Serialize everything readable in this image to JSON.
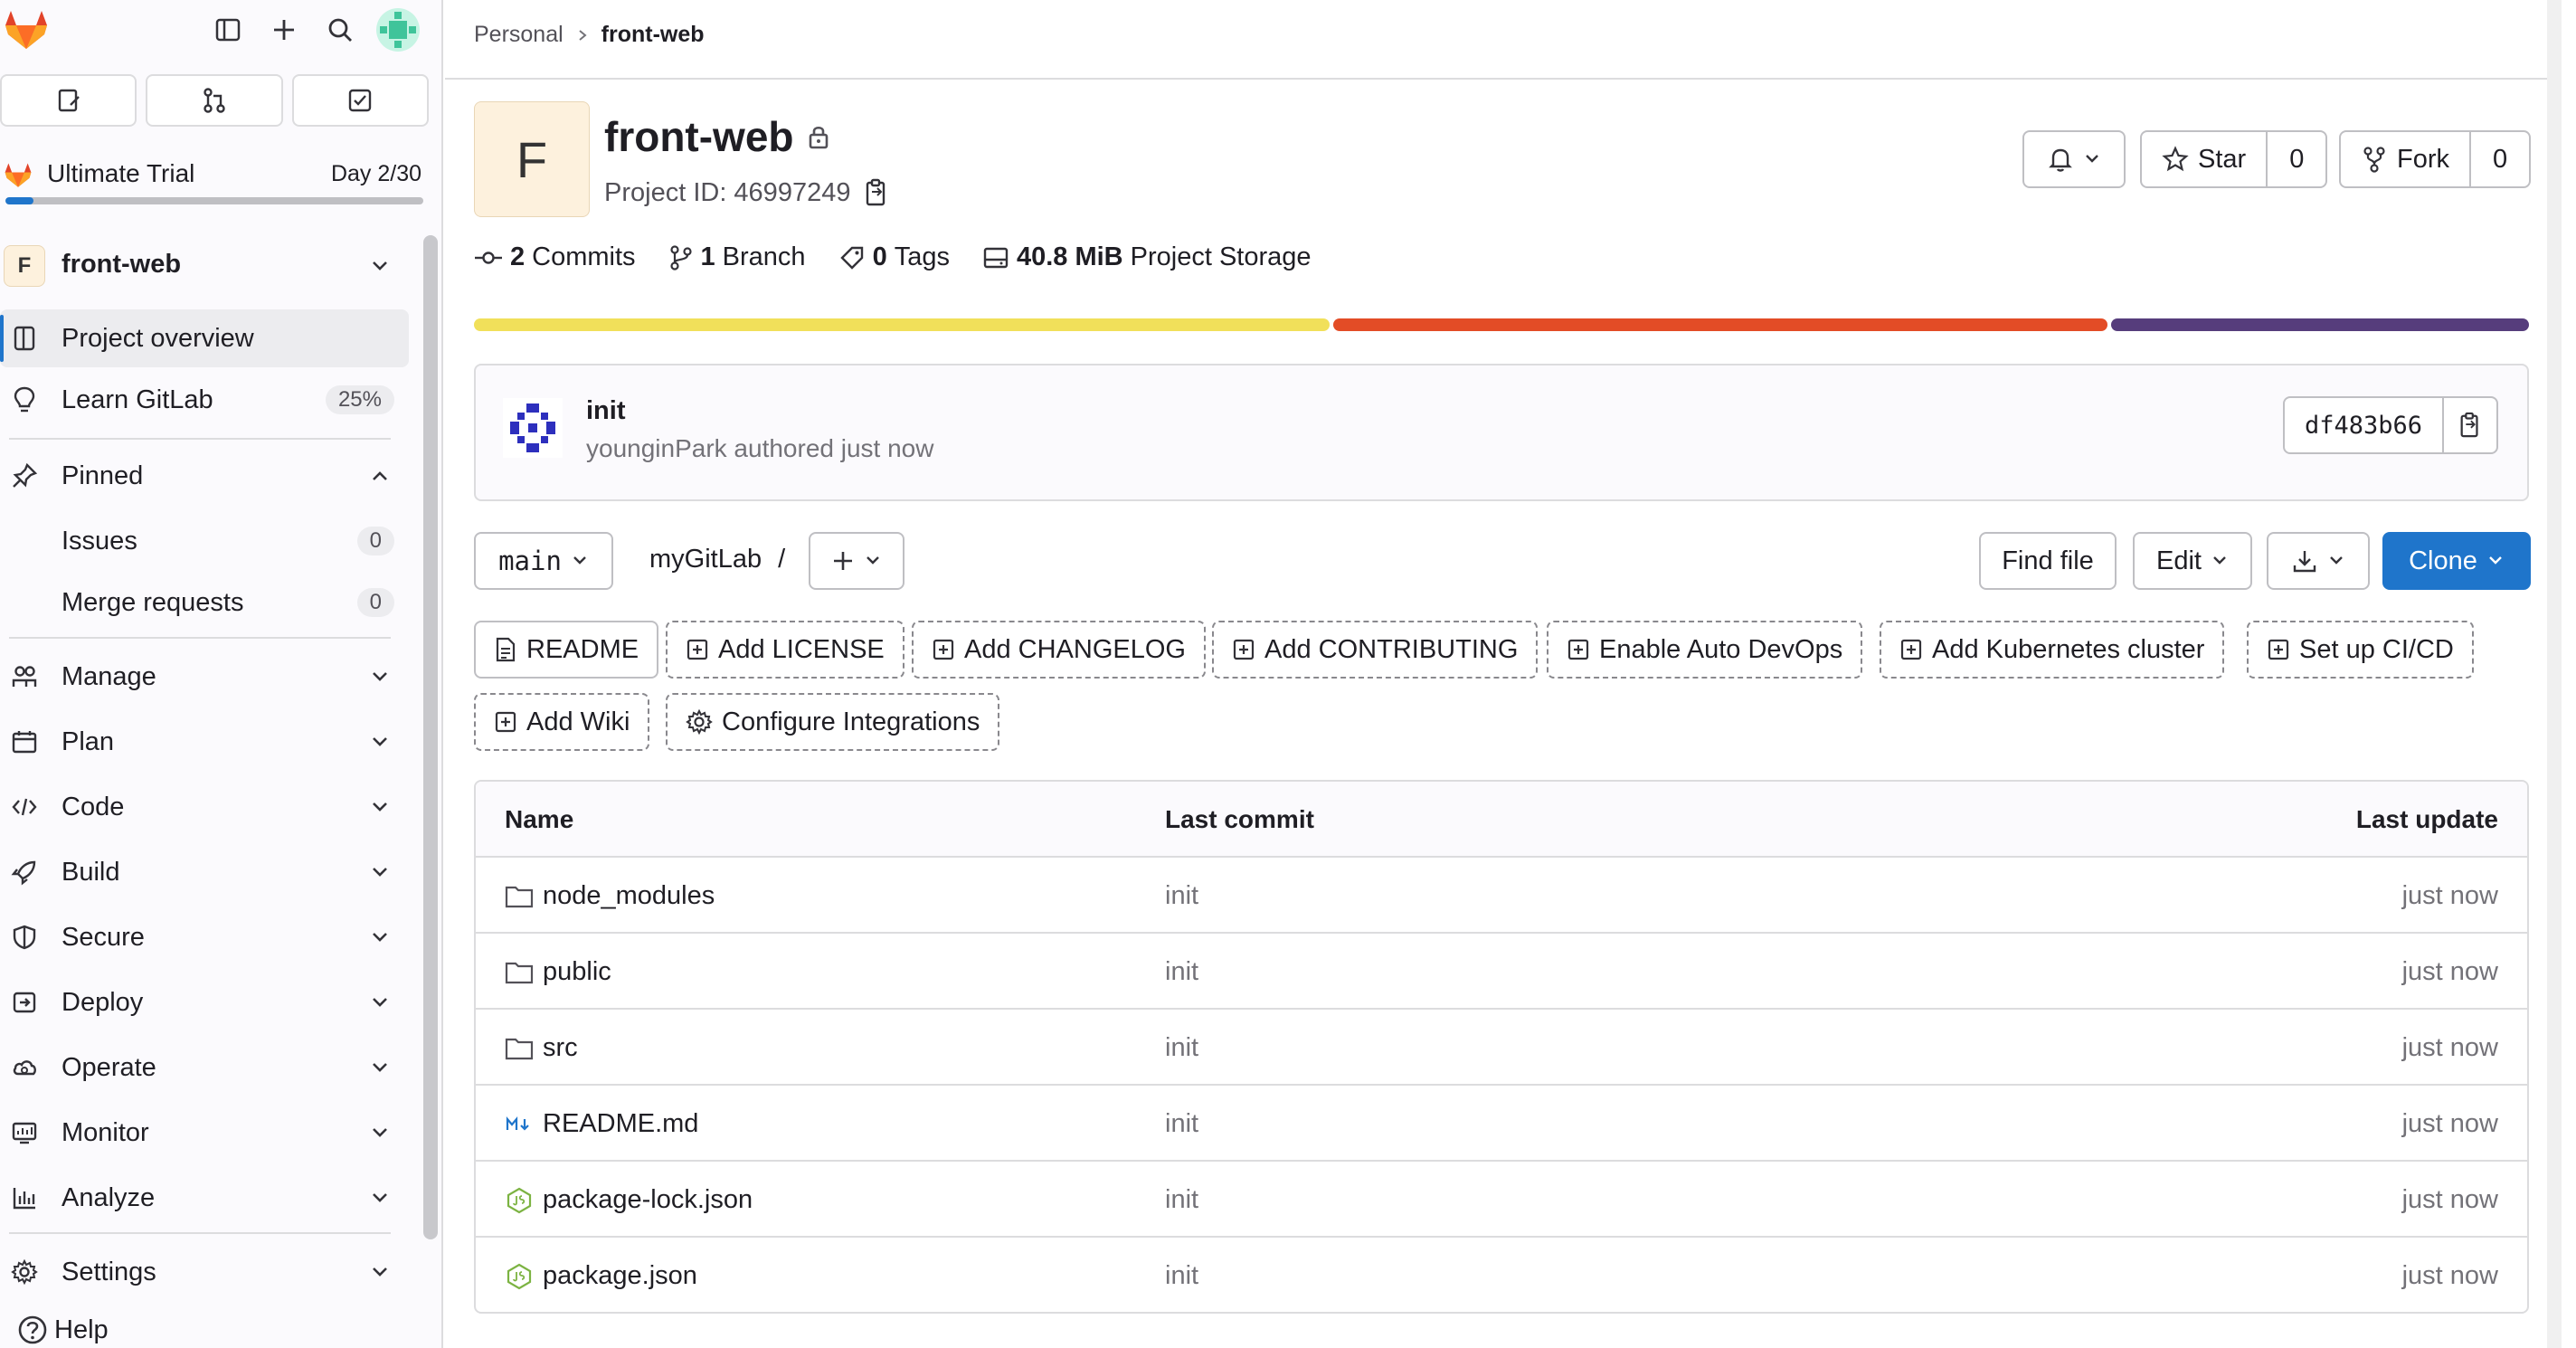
{
  "sidebar": {
    "trial_label": "Ultimate Trial",
    "trial_day": "Day 2/30",
    "trial_progress": 0.067,
    "project_initial": "F",
    "project_name": "front-web",
    "nav": [
      {
        "label": "Project overview",
        "icon": "project-icon",
        "active": true
      },
      {
        "label": "Learn GitLab",
        "icon": "bulb-icon",
        "badge": "25%"
      }
    ],
    "pinned_label": "Pinned",
    "pinned": [
      {
        "label": "Issues",
        "badge": "0"
      },
      {
        "label": "Merge requests",
        "badge": "0"
      }
    ],
    "sections": [
      {
        "label": "Manage",
        "icon": "users-icon"
      },
      {
        "label": "Plan",
        "icon": "planning-icon"
      },
      {
        "label": "Code",
        "icon": "code-icon"
      },
      {
        "label": "Build",
        "icon": "rocket-icon"
      },
      {
        "label": "Secure",
        "icon": "shield-icon"
      },
      {
        "label": "Deploy",
        "icon": "deploy-icon"
      },
      {
        "label": "Operate",
        "icon": "cloud-gear-icon"
      },
      {
        "label": "Monitor",
        "icon": "monitor-icon"
      },
      {
        "label": "Analyze",
        "icon": "chart-icon"
      }
    ],
    "settings_label": "Settings",
    "help_label": "Help"
  },
  "breadcrumb": {
    "parent": "Personal",
    "current": "front-web"
  },
  "project": {
    "initial": "F",
    "title": "front-web",
    "id_text": "Project ID: 46997249"
  },
  "actions": {
    "star_label": "Star",
    "star_count": "0",
    "fork_label": "Fork",
    "fork_count": "0"
  },
  "stats": {
    "commits_num": "2",
    "commits_label": "Commits",
    "branch_num": "1",
    "branch_label": "Branch",
    "tags_num": "0",
    "tags_label": "Tags",
    "storage_num": "40.8 MiB",
    "storage_label": "Project Storage"
  },
  "languages": [
    {
      "share": 41.8,
      "color": "#f1e05a"
    },
    {
      "share": 37.8,
      "color": "#e34c26"
    },
    {
      "share": 20.4,
      "color": "#563d7c"
    }
  ],
  "commit": {
    "title": "init",
    "meta": "younginPark authored just now",
    "sha": "df483b66"
  },
  "repo": {
    "branch": "main",
    "path": "myGitLab",
    "path_sep": "/",
    "find_file": "Find file",
    "edit": "Edit",
    "clone": "Clone"
  },
  "quick_actions": [
    "README",
    "Add LICENSE",
    "Add CHANGELOG",
    "Add CONTRIBUTING",
    "Enable Auto DevOps",
    "Add Kubernetes cluster",
    "Set up CI/CD",
    "Add Wiki",
    "Configure Integrations"
  ],
  "table": {
    "headers": {
      "name": "Name",
      "commit": "Last commit",
      "update": "Last update"
    },
    "rows": [
      {
        "name": "node_modules",
        "type": "folder",
        "commit": "init",
        "update": "just now"
      },
      {
        "name": "public",
        "type": "folder",
        "commit": "init",
        "update": "just now"
      },
      {
        "name": "src",
        "type": "folder",
        "commit": "init",
        "update": "just now"
      },
      {
        "name": "README.md",
        "type": "markdown",
        "commit": "init",
        "update": "just now"
      },
      {
        "name": "package-lock.json",
        "type": "node",
        "commit": "init",
        "update": "just now"
      },
      {
        "name": "package.json",
        "type": "node",
        "commit": "init",
        "update": "just now"
      }
    ]
  }
}
